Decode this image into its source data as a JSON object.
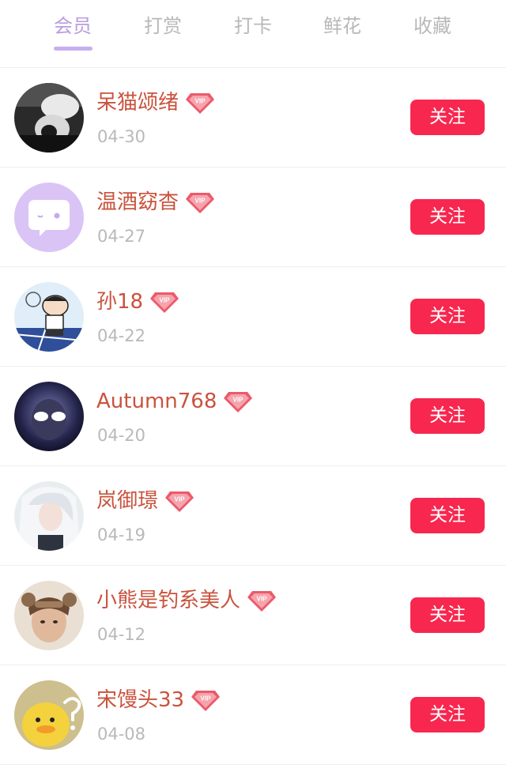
{
  "tabs": [
    {
      "label": "会员",
      "active": true
    },
    {
      "label": "打赏",
      "active": false
    },
    {
      "label": "打卡",
      "active": false
    },
    {
      "label": "鲜花",
      "active": false
    },
    {
      "label": "收藏",
      "active": false
    }
  ],
  "members": [
    {
      "name": "呆猫颂绪",
      "date": "04-30",
      "follow_label": "关注",
      "vip_icon": "vip-diamond-icon"
    },
    {
      "name": "温酒窈杳",
      "date": "04-27",
      "follow_label": "关注",
      "vip_icon": "vip-diamond-icon"
    },
    {
      "name": "孙18",
      "date": "04-22",
      "follow_label": "关注",
      "vip_icon": "vip-diamond-icon"
    },
    {
      "name": "Autumn768",
      "date": "04-20",
      "follow_label": "关注",
      "vip_icon": "vip-diamond-icon"
    },
    {
      "name": "岚御璟",
      "date": "04-19",
      "follow_label": "关注",
      "vip_icon": "vip-diamond-icon"
    },
    {
      "name": "小熊是钓系美人",
      "date": "04-12",
      "follow_label": "关注",
      "vip_icon": "vip-diamond-icon"
    },
    {
      "name": "宋馒头33",
      "date": "04-08",
      "follow_label": "关注",
      "vip_icon": "vip-diamond-icon"
    }
  ],
  "colors": {
    "active_tab": "#b89ddf",
    "inactive_tab": "#b8b8b8",
    "name": "#c9533d",
    "follow_button": "#f7274f",
    "vip_badge": "#ec5a6a"
  }
}
